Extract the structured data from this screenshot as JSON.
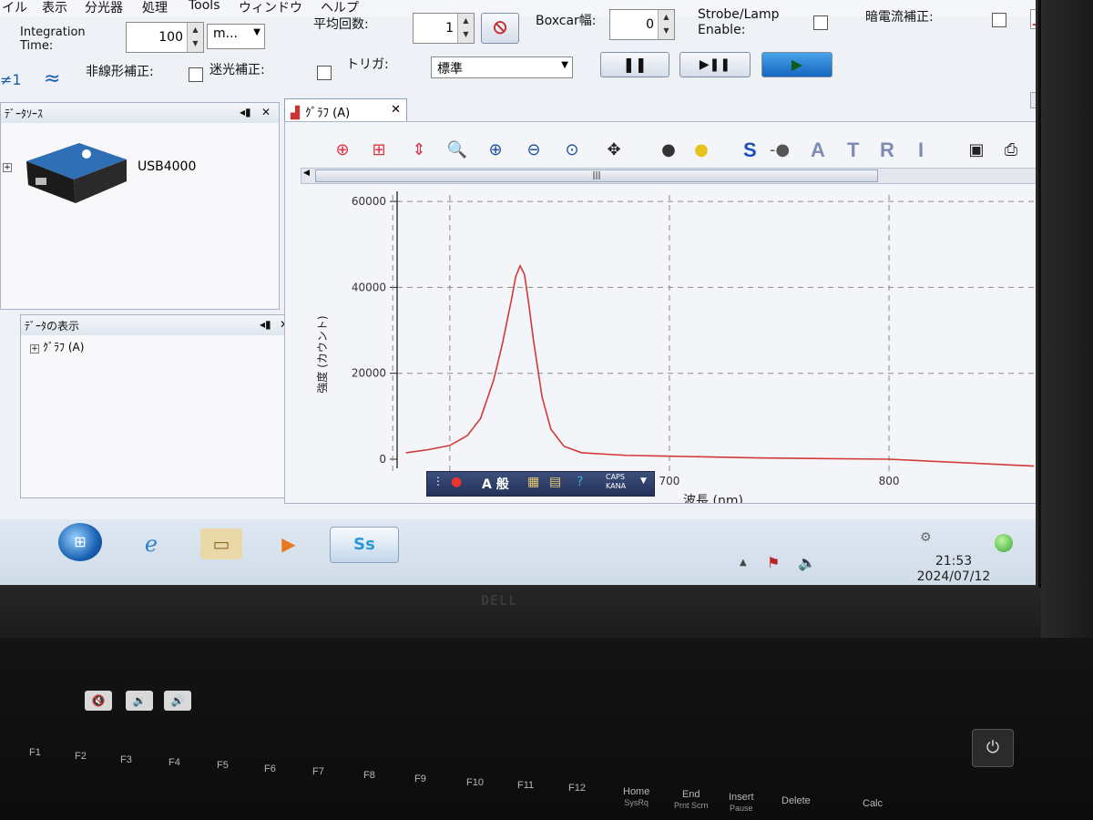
{
  "menu": {
    "items": [
      "イル",
      "表示",
      "分光器",
      "処理",
      "Tools",
      "ウィンドウ",
      "ヘルプ"
    ]
  },
  "toolbar": {
    "integration_label": "Integration Time:",
    "integration_value": "100",
    "integration_unit": "m...",
    "averaging_label": "平均回数:",
    "averaging_value": "1",
    "boxcar_label": "Boxcar幅:",
    "boxcar_value": "0",
    "strobe_label": "Strobe/Lamp Enable:",
    "dark_label": "暗電流補正:",
    "nonlinear_label": "非線形補正:",
    "stray_label": "迷光補正:",
    "trigger_label": "トリガ:",
    "trigger_value": "標準",
    "neq_label": "≠1",
    "pause_symbol": "❚❚",
    "step_symbol": "▶❚❚",
    "play_symbol": "▶"
  },
  "data_source_pane": {
    "title": "ﾃﾞｰﾀｿｰｽ",
    "device": "USB4000"
  },
  "data_view_pane": {
    "title": "ﾃﾞｰﾀの表示",
    "tree_item": "ｸﾞﾗﾌ (A)"
  },
  "graph_tab": {
    "label": "ｸﾞﾗﾌ (A)"
  },
  "graph_toolbar": {
    "letters": [
      "S",
      "A",
      "T",
      "R",
      "I"
    ]
  },
  "taskbar": {
    "time": "21:53",
    "date": "2024/07/12",
    "ime_mode": "A 般",
    "ime_caps": "CAPS",
    "ime_kana": "KANA"
  },
  "keyboard": {
    "fkeys": [
      "F1",
      "F2",
      "F3",
      "F4",
      "F5",
      "F6",
      "F7",
      "F8",
      "F9",
      "F10",
      "F11",
      "F12"
    ],
    "nav": [
      "Home",
      "End",
      "Insert",
      "Delete",
      "Calc"
    ],
    "nav_sub": [
      "SysRq",
      "Prnt Scrn",
      "Pause"
    ]
  },
  "chart_data": {
    "type": "line",
    "xlabel": "波長 (nm)",
    "ylabel": "強度 (カウント)",
    "y_ticks": [
      0,
      20000,
      40000,
      60000
    ],
    "x_ticks": [
      600,
      700,
      800
    ],
    "xlim": [
      576,
      868
    ],
    "ylim": [
      0,
      61500
    ],
    "grid": true,
    "series": [
      {
        "color": "#d23a3a",
        "x": [
          580,
          590,
          600,
          608,
          614,
          620,
          624,
          628,
          630,
          632,
          634,
          636,
          638,
          642,
          646,
          652,
          660,
          680,
          700,
          740,
          800,
          866
        ],
        "y": [
          1500,
          2200,
          3200,
          5500,
          9500,
          18500,
          27000,
          37000,
          42500,
          45000,
          43000,
          36000,
          28000,
          14500,
          7000,
          3000,
          1500,
          900,
          700,
          300,
          0,
          -1600
        ]
      }
    ]
  }
}
